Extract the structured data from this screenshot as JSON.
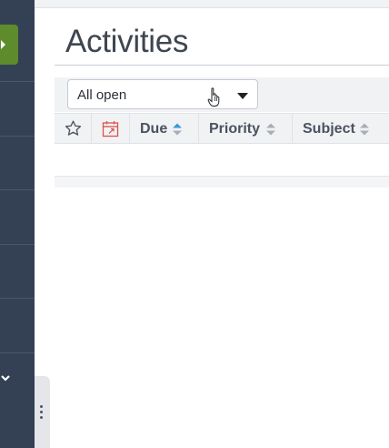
{
  "page": {
    "title": "Activities"
  },
  "filter": {
    "selected": "All open"
  },
  "table": {
    "columns": [
      {
        "key": "star",
        "icon": "star-icon"
      },
      {
        "key": "calendar",
        "icon": "calendar-icon"
      },
      {
        "key": "due",
        "label": "Due"
      },
      {
        "key": "priority",
        "label": "Priority"
      },
      {
        "key": "subject",
        "label": "Subject"
      }
    ]
  },
  "colors": {
    "sidebar": "#344154",
    "accent_green": "#5e8b2c",
    "sort_active": "#3a9bd5",
    "calendar_icon": "#d9534f"
  }
}
